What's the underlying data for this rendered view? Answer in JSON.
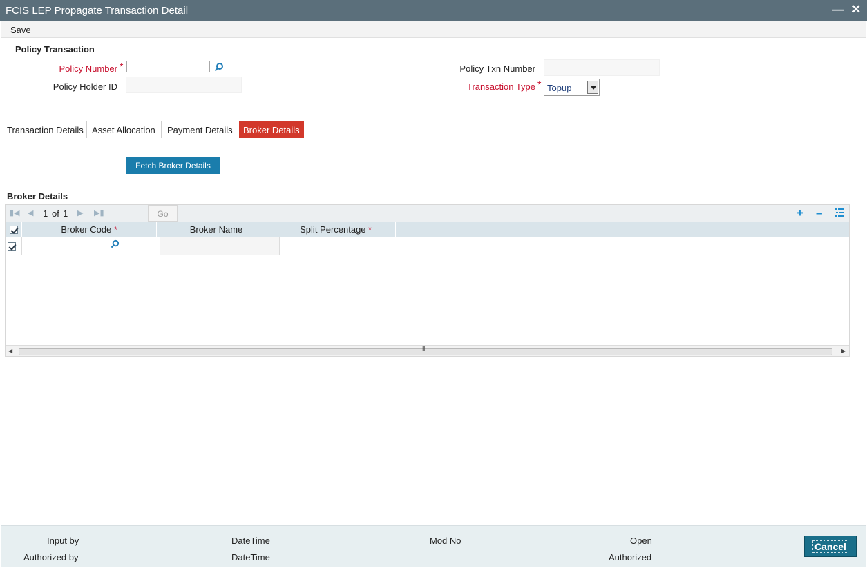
{
  "window": {
    "title": "FCIS LEP Propagate Transaction Detail"
  },
  "toolbar": {
    "save_label": "Save"
  },
  "policy": {
    "section_title": "Policy Transaction",
    "policy_number_label": "Policy Number",
    "policy_number_value": "",
    "policy_holder_label": "Policy Holder ID",
    "policy_holder_value": "",
    "txn_number_label": "Policy Txn Number",
    "txn_number_value": "",
    "txn_type_label": "Transaction Type",
    "txn_type_value": "Topup",
    "required_mark": "*"
  },
  "tabs": [
    {
      "label": "Transaction Details",
      "active": false
    },
    {
      "label": "Asset Allocation",
      "active": false
    },
    {
      "label": "Payment Details",
      "active": false
    },
    {
      "label": "Broker Details",
      "active": true
    }
  ],
  "fetch_button": "Fetch Broker Details",
  "broker_grid": {
    "title": "Broker Details",
    "pager": {
      "current": "1",
      "of_label": "of",
      "total": "1",
      "go_label": "Go"
    },
    "columns": [
      {
        "label": "Broker Code",
        "required": true
      },
      {
        "label": "Broker Name",
        "required": false
      },
      {
        "label": "Split Percentage",
        "required": true
      }
    ],
    "required_mark": "*",
    "rows": [
      {
        "checked": true,
        "broker_code": "",
        "broker_name": "",
        "split_percentage": ""
      }
    ],
    "scroll_grip": "III"
  },
  "footer": {
    "input_by": "Input by",
    "authorized_by": "Authorized by",
    "datetime_1": "DateTime",
    "datetime_2": "DateTime",
    "mod_no": "Mod No",
    "open": "Open",
    "authorized": "Authorized",
    "cancel_label": "Cancel"
  },
  "colors": {
    "titlebar": "#5b6f7b",
    "active_tab": "#d2382b",
    "primary_button": "#1a7dac",
    "required": "#c8102e",
    "footer": "#e7eff1"
  },
  "icons": {
    "lookup": "magnifier-icon",
    "minimize": "minimize-icon",
    "close": "close-icon",
    "first": "first-page-icon",
    "prev": "prev-page-icon",
    "next": "next-page-icon",
    "last": "last-page-icon",
    "add": "add-row-icon",
    "remove": "delete-row-icon",
    "columns": "column-settings-icon"
  }
}
